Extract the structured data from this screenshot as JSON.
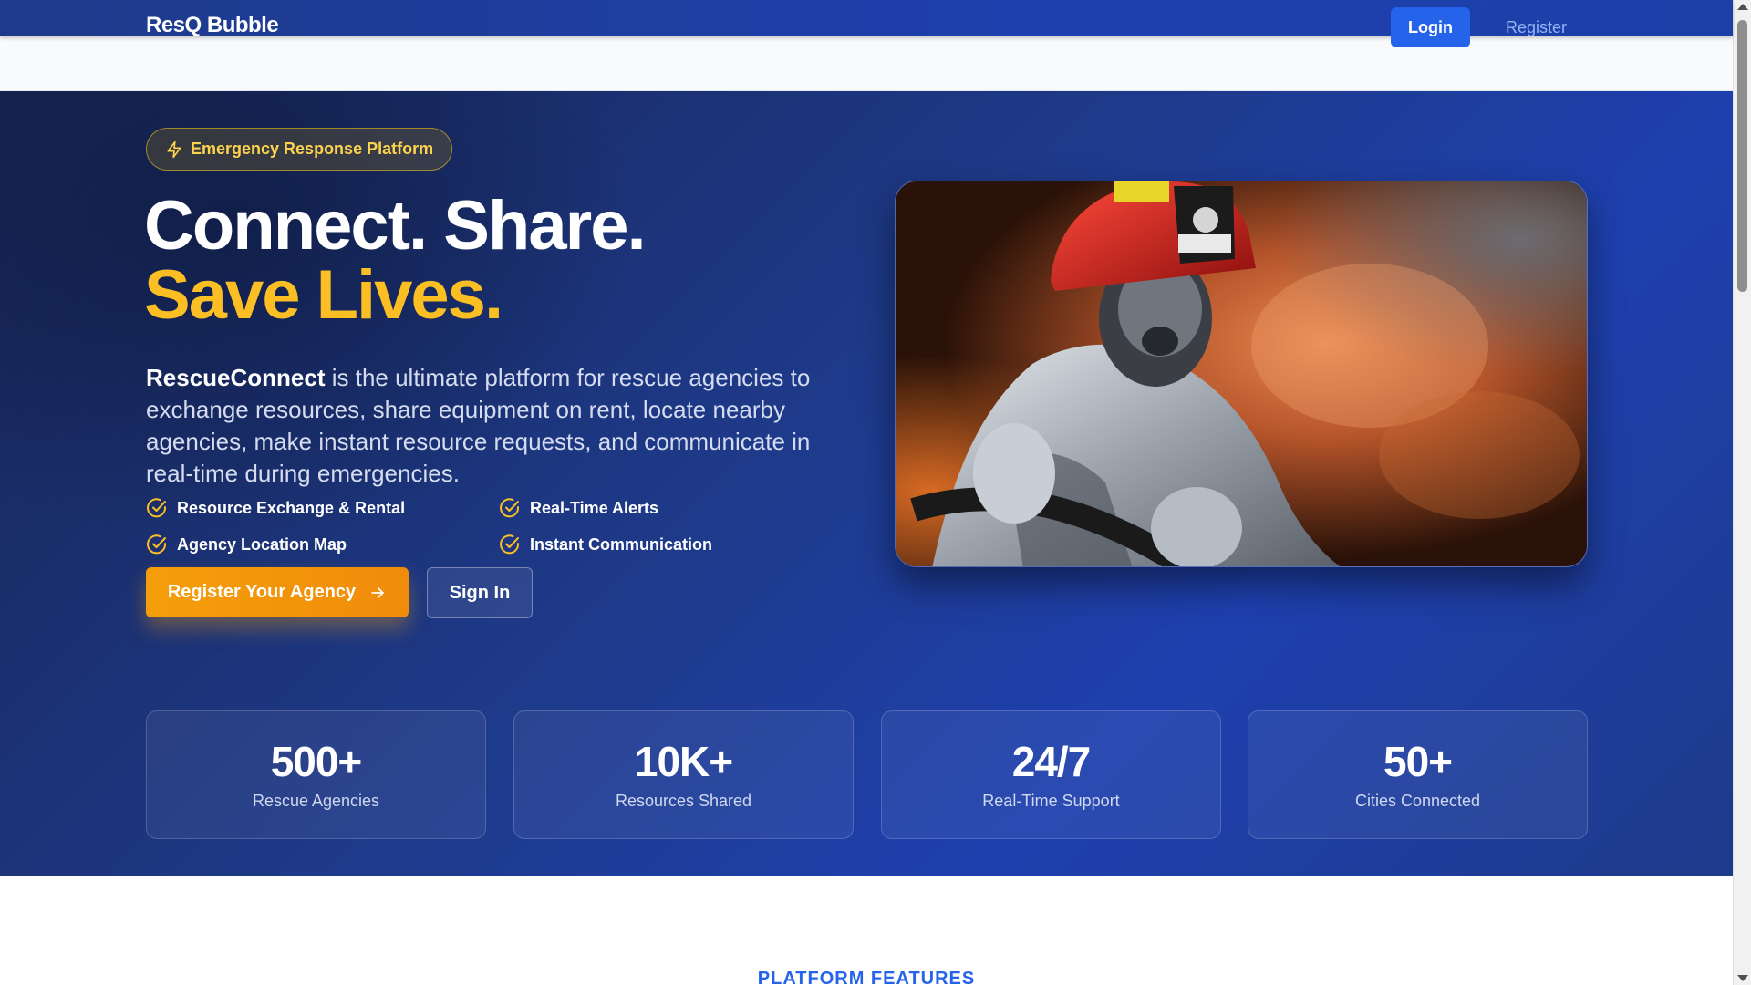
{
  "nav": {
    "brand": "ResQ Bubble",
    "login_label": "Login",
    "register_label": "Register"
  },
  "hero": {
    "badge_icon": "lightning-icon",
    "badge_text": "Emergency Response Platform",
    "headline_line1": "Connect. Share.",
    "headline_line2": "Save Lives.",
    "description_brand": "RescueConnect",
    "description_rest": " is the ultimate platform for rescue agencies to exchange resources, share equipment on rent, locate nearby agencies, make instant resource requests, and communicate in real-time during emergencies.",
    "features": [
      {
        "label": "Resource Exchange & Rental",
        "icon": "check-circle-icon"
      },
      {
        "label": "Real-Time Alerts",
        "icon": "check-circle-icon"
      },
      {
        "label": "Agency Location Map",
        "icon": "check-circle-icon"
      },
      {
        "label": "Instant Communication",
        "icon": "check-circle-icon"
      }
    ],
    "cta_primary": "Register Your Agency",
    "cta_primary_icon": "arrow-right-icon",
    "cta_secondary": "Sign In",
    "image": "firefighter-photo"
  },
  "stats": [
    {
      "value": "500+",
      "label": "Rescue Agencies"
    },
    {
      "value": "10K+",
      "label": "Resources Shared"
    },
    {
      "value": "24/7",
      "label": "Real-Time Support"
    },
    {
      "value": "50+",
      "label": "Cities Connected"
    }
  ],
  "features_section": {
    "heading": "PLATFORM FEATURES"
  },
  "colors": {
    "nav_bg": "#1e40af",
    "hero_bg": "#1e3a8a",
    "accent_yellow": "#fbbf24",
    "cta_orange": "#f59e0b",
    "login_blue": "#2563eb"
  }
}
